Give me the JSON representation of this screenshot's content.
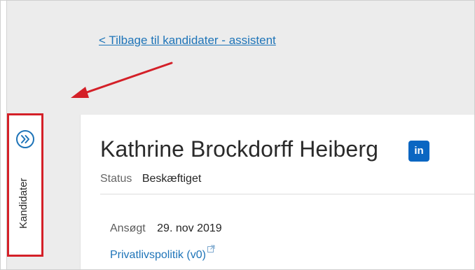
{
  "back_link": {
    "label": "< Tilbage til kandidater - assistent"
  },
  "sidebar": {
    "label": "Kandidater",
    "expand_icon": "double-chevron-right-icon",
    "highlight_color": "#d42028"
  },
  "candidate": {
    "name": "Kathrine Brockdorff Heiberg",
    "linkedin_label": "in",
    "status_label": "Status",
    "status_value": "Beskæftiget",
    "applied_label": "Ansøgt",
    "applied_date": "29. nov 2019",
    "privacy_link": "Privatlivspolitik (v0)",
    "privacy_icon": "external-link-icon"
  },
  "colors": {
    "link": "#1e74b8",
    "linkedin": "#0a66c2",
    "annotation": "#d42028"
  }
}
